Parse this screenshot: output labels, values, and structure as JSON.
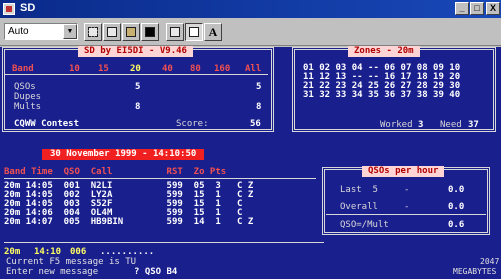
{
  "window": {
    "title": "SD",
    "min": "_",
    "max": "□",
    "close": "X"
  },
  "toolbar": {
    "font_value": "Auto",
    "dropdown_arrow": "▼",
    "btn_a_label": "A"
  },
  "main_panel": {
    "header": "SD by EI5DI - V9.46",
    "band_label": "Band",
    "bands": [
      "10",
      "15",
      "20",
      "40",
      "80",
      "160",
      "All"
    ],
    "rows": [
      {
        "label": "QSOs",
        "v20": "5",
        "all": "5"
      },
      {
        "label": "Dupes",
        "v20": "",
        "all": ""
      },
      {
        "label": "Mults",
        "v20": "8",
        "all": "8"
      }
    ],
    "contest": "CQWW Contest",
    "score_label": "Score:",
    "score": "56"
  },
  "zones": {
    "header": "Zones - 20m",
    "rows": [
      "01 02 03 04 -- 06 07 08 09 10",
      "11 12 13 -- -- 16 17 18 19 20",
      "21 22 23 24 25 26 27 28 29 30",
      "31 32 33 34 35 36 37 38 39 40"
    ],
    "worked_label": "Worked",
    "worked": "3",
    "need_label": "Need",
    "need": "37"
  },
  "date_banner": "30 November 1999 - 14:10:50",
  "log": {
    "headers": "Band Time  QSO  Call          RST  Zo Pts",
    "rows": [
      "20m 14:05  001  N2LI          599  05  3   C Z",
      "20m 14:05  002  LY2A          599  15  1   C Z",
      "20m 14:05  003  S52F          599  15  1   C",
      "20m 14:06  004  OL4M          599  15  1   C",
      "20m 14:07  005  HB9BIN        599  14  1   C Z"
    ],
    "entry_band": "20m",
    "entry_time": "14:10",
    "entry_qso": "006",
    "entry_call": ".........."
  },
  "rate": {
    "header": "QSOs per hour",
    "rows": [
      {
        "label": "Last  5",
        "value": "0.0"
      },
      {
        "label": "Overall",
        "value": "0.0"
      },
      {
        "label": "QSO=/Mult",
        "value": "0.6"
      }
    ]
  },
  "status": {
    "line1": "Current F5 message is TU",
    "line2": "Enter new message",
    "line2_tail": "? QSO B4",
    "mem": "2047",
    "megabytes": "MEGABYTES"
  }
}
